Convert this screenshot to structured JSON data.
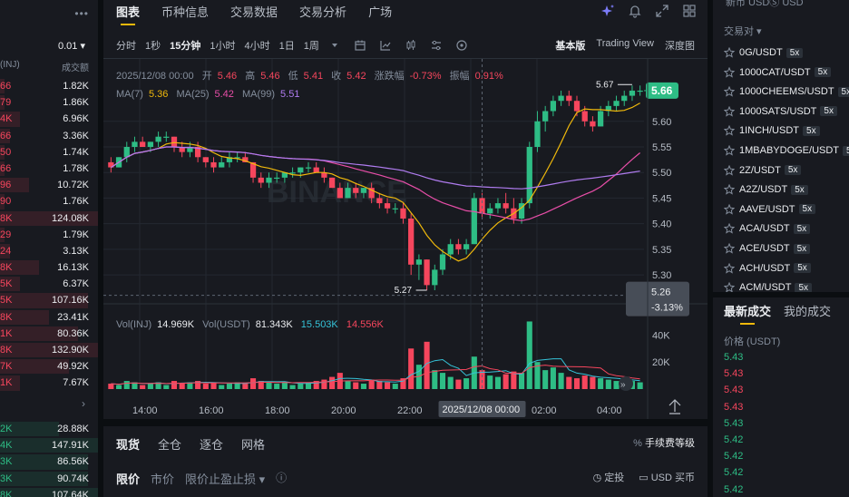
{
  "orderbook": {
    "menu_icon": "more-dots-icon",
    "precision": "0.01 ▾",
    "col_price": "(INJ)",
    "col_total": "成交额",
    "asks": [
      {
        "price": "66",
        "total": "1.82K",
        "depth": 0.05
      },
      {
        "price": "79",
        "total": "1.86K",
        "depth": 0.05
      },
      {
        "price": "4K",
        "total": "6.96K",
        "depth": 0.2
      },
      {
        "price": "66",
        "total": "3.36K",
        "depth": 0.1
      },
      {
        "price": "50",
        "total": "1.74K",
        "depth": 0.05
      },
      {
        "price": "66",
        "total": "1.78K",
        "depth": 0.05
      },
      {
        "price": "96",
        "total": "10.72K",
        "depth": 0.3
      },
      {
        "price": "90",
        "total": "1.76K",
        "depth": 0.05
      },
      {
        "price": "8K",
        "total": "124.08K",
        "depth": 1.0
      },
      {
        "price": "29",
        "total": "1.79K",
        "depth": 0.05
      },
      {
        "price": "24",
        "total": "3.13K",
        "depth": 0.1
      },
      {
        "price": "8K",
        "total": "16.13K",
        "depth": 0.4
      },
      {
        "price": "5K",
        "total": "6.37K",
        "depth": 0.2
      },
      {
        "price": "5K",
        "total": "107.16K",
        "depth": 0.9
      },
      {
        "price": "8K",
        "total": "23.41K",
        "depth": 0.5
      },
      {
        "price": "1K",
        "total": "80.36K",
        "depth": 0.8
      },
      {
        "price": "8K",
        "total": "132.90K",
        "depth": 1.0
      },
      {
        "price": "7K",
        "total": "49.92K",
        "depth": 0.7
      },
      {
        "price": "1K",
        "total": "7.67K",
        "depth": 0.2
      }
    ],
    "mid_arrow": "›",
    "bids": [
      {
        "price": "2K",
        "total": "28.88K",
        "depth": 0.6
      },
      {
        "price": "4K",
        "total": "147.91K",
        "depth": 1.0
      },
      {
        "price": "3K",
        "total": "86.56K",
        "depth": 0.9
      },
      {
        "price": "3K",
        "total": "90.74K",
        "depth": 0.9
      },
      {
        "price": "8K",
        "total": "107.64K",
        "depth": 1.0
      }
    ]
  },
  "chart_panel": {
    "tabs": [
      {
        "label": "图表",
        "active": true
      },
      {
        "label": "币种信息",
        "active": false
      },
      {
        "label": "交易数据",
        "active": false
      },
      {
        "label": "交易分析",
        "active": false
      },
      {
        "label": "广场",
        "active": false
      }
    ],
    "top_icons": [
      "sparkle-icon",
      "bell-icon",
      "expand-icon",
      "grid-icon"
    ],
    "intervals": [
      {
        "label": "分时",
        "active": false
      },
      {
        "label": "1秒",
        "active": false
      },
      {
        "label": "15分钟",
        "active": true
      },
      {
        "label": "1小时",
        "active": false
      },
      {
        "label": "4小时",
        "active": false
      },
      {
        "label": "1日",
        "active": false
      },
      {
        "label": "1周",
        "active": false
      }
    ],
    "tool_icons": [
      "caret-down-icon",
      "calendar-icon",
      "line-chart-icon",
      "candles-icon",
      "settings-sliders-icon",
      "target-icon"
    ],
    "views": [
      {
        "label": "基本版",
        "active": true
      },
      {
        "label": "Trading View",
        "active": false
      },
      {
        "label": "深度图",
        "active": false
      }
    ],
    "ohlc": {
      "date": "2025/12/08 00:00",
      "open_label": "开",
      "open": "5.46",
      "high_label": "高",
      "high": "5.46",
      "low_label": "低",
      "low": "5.41",
      "close_label": "收",
      "close": "5.42",
      "chg_label": "涨跌幅",
      "chg": "-0.73%",
      "amp_label": "振幅",
      "amp": "0.91%"
    },
    "ma": {
      "ma7_label": "MA(7)",
      "ma7": "5.36",
      "ma25_label": "MA(25)",
      "ma25": "5.42",
      "ma99_label": "MA(99)",
      "ma99": "5.51"
    },
    "vol": {
      "label_inj": "Vol(INJ)",
      "inj": "14.969K",
      "label_usdt": "Vol(USDT)",
      "usdt": "81.343K",
      "v1": "15.503K",
      "v2": "14.556K"
    },
    "watermark": "BINANCE",
    "last_price": "5.66",
    "cursor_price": "5.26",
    "cursor_pct": "-3.13%",
    "high_marker": "5.67",
    "low_marker": "5.27",
    "cursor_time": "2025/12/08 00:00",
    "price_ticks": [
      "5.60",
      "5.55",
      "5.50",
      "5.45",
      "5.40",
      "5.35",
      "5.30"
    ],
    "vol_ticks": [
      "40K",
      "20K"
    ],
    "time_ticks": [
      "14:00",
      "16:00",
      "18:00",
      "20:00",
      "22:00",
      "02:00",
      "04:00"
    ],
    "colors": {
      "up": "#2ebd85",
      "down": "#f6465d",
      "ma7": "#f0b90b",
      "ma25": "#e84ea8",
      "ma99": "#b07cf0",
      "vol_ma": "#35c3d8"
    }
  },
  "chart_data": {
    "type": "candlestick",
    "interval": "15m",
    "ylim": [
      5.27,
      5.69
    ],
    "volume_ylim": [
      0,
      55000
    ],
    "candles": [
      [
        5.52,
        5.53,
        5.5,
        5.51
      ],
      [
        5.51,
        5.53,
        5.51,
        5.53
      ],
      [
        5.53,
        5.56,
        5.52,
        5.55
      ],
      [
        5.55,
        5.57,
        5.54,
        5.56
      ],
      [
        5.56,
        5.57,
        5.55,
        5.55
      ],
      [
        5.55,
        5.56,
        5.54,
        5.56
      ],
      [
        5.56,
        5.58,
        5.55,
        5.57
      ],
      [
        5.57,
        5.58,
        5.56,
        5.57
      ],
      [
        5.57,
        5.57,
        5.54,
        5.55
      ],
      [
        5.55,
        5.56,
        5.53,
        5.54
      ],
      [
        5.54,
        5.56,
        5.53,
        5.55
      ],
      [
        5.55,
        5.56,
        5.52,
        5.53
      ],
      [
        5.53,
        5.53,
        5.51,
        5.52
      ],
      [
        5.52,
        5.53,
        5.5,
        5.51
      ],
      [
        5.51,
        5.53,
        5.51,
        5.52
      ],
      [
        5.52,
        5.54,
        5.51,
        5.53
      ],
      [
        5.53,
        5.54,
        5.52,
        5.53
      ],
      [
        5.53,
        5.54,
        5.52,
        5.52
      ],
      [
        5.52,
        5.52,
        5.48,
        5.49
      ],
      [
        5.49,
        5.5,
        5.47,
        5.48
      ],
      [
        5.48,
        5.5,
        5.47,
        5.49
      ],
      [
        5.49,
        5.5,
        5.48,
        5.49
      ],
      [
        5.49,
        5.5,
        5.48,
        5.5
      ],
      [
        5.5,
        5.51,
        5.49,
        5.5
      ],
      [
        5.5,
        5.51,
        5.49,
        5.51
      ],
      [
        5.51,
        5.52,
        5.5,
        5.51
      ],
      [
        5.51,
        5.52,
        5.5,
        5.5
      ],
      [
        5.5,
        5.51,
        5.48,
        5.49
      ],
      [
        5.49,
        5.49,
        5.47,
        5.47
      ],
      [
        5.47,
        5.48,
        5.45,
        5.45
      ],
      [
        5.45,
        5.48,
        5.45,
        5.47
      ],
      [
        5.47,
        5.48,
        5.45,
        5.46
      ],
      [
        5.46,
        5.47,
        5.45,
        5.47
      ],
      [
        5.47,
        5.48,
        5.44,
        5.45
      ],
      [
        5.45,
        5.46,
        5.43,
        5.44
      ],
      [
        5.44,
        5.45,
        5.42,
        5.43
      ],
      [
        5.43,
        5.44,
        5.42,
        5.43
      ],
      [
        5.43,
        5.44,
        5.4,
        5.41
      ],
      [
        5.41,
        5.42,
        5.3,
        5.32
      ],
      [
        5.32,
        5.34,
        5.29,
        5.33
      ],
      [
        5.33,
        5.33,
        5.27,
        5.28
      ],
      [
        5.28,
        5.32,
        5.27,
        5.31
      ],
      [
        5.31,
        5.35,
        5.3,
        5.34
      ],
      [
        5.34,
        5.37,
        5.33,
        5.36
      ],
      [
        5.36,
        5.37,
        5.34,
        5.35
      ],
      [
        5.35,
        5.37,
        5.34,
        5.36
      ],
      [
        5.36,
        5.46,
        5.36,
        5.45
      ],
      [
        5.45,
        5.46,
        5.41,
        5.42
      ],
      [
        5.42,
        5.44,
        5.41,
        5.43
      ],
      [
        5.43,
        5.45,
        5.42,
        5.44
      ],
      [
        5.44,
        5.46,
        5.42,
        5.43
      ],
      [
        5.43,
        5.45,
        5.4,
        5.41
      ],
      [
        5.41,
        5.45,
        5.4,
        5.44
      ],
      [
        5.44,
        5.56,
        5.43,
        5.55
      ],
      [
        5.55,
        5.62,
        5.54,
        5.6
      ],
      [
        5.6,
        5.63,
        5.58,
        5.62
      ],
      [
        5.62,
        5.65,
        5.61,
        5.64
      ],
      [
        5.64,
        5.66,
        5.63,
        5.65
      ],
      [
        5.65,
        5.66,
        5.63,
        5.64
      ],
      [
        5.64,
        5.65,
        5.61,
        5.62
      ],
      [
        5.62,
        5.63,
        5.59,
        5.6
      ],
      [
        5.6,
        5.61,
        5.58,
        5.59
      ],
      [
        5.59,
        5.63,
        5.59,
        5.62
      ],
      [
        5.62,
        5.64,
        5.61,
        5.63
      ],
      [
        5.63,
        5.65,
        5.62,
        5.64
      ],
      [
        5.64,
        5.66,
        5.63,
        5.65
      ],
      [
        5.65,
        5.67,
        5.64,
        5.66
      ],
      [
        5.66,
        5.67,
        5.65,
        5.66
      ]
    ],
    "volumes": [
      4,
      3,
      6,
      5,
      3,
      4,
      5,
      3,
      6,
      4,
      5,
      6,
      4,
      5,
      3,
      4,
      5,
      4,
      8,
      6,
      5,
      4,
      5,
      3,
      4,
      5,
      6,
      7,
      9,
      12,
      6,
      5,
      4,
      7,
      6,
      5,
      4,
      8,
      30,
      18,
      35,
      14,
      12,
      9,
      7,
      8,
      24,
      14,
      10,
      9,
      11,
      13,
      12,
      50,
      20,
      14,
      16,
      12,
      9,
      8,
      10,
      9,
      8,
      7,
      6,
      7,
      6,
      5
    ]
  },
  "trade_panel": {
    "tabs": [
      {
        "label": "现货",
        "active": true
      },
      {
        "label": "全仓",
        "active": false
      },
      {
        "label": "逐仓",
        "active": false
      },
      {
        "label": "网格",
        "active": false
      }
    ],
    "fee_label": "手续费等级",
    "fee_icon": "percent-icon",
    "order_types": [
      {
        "label": "限价",
        "active": true
      },
      {
        "label": "市价",
        "active": false
      },
      {
        "label": "限价止盈止损 ▾",
        "active": false
      }
    ],
    "info_icon": "info-icon",
    "dca_label": "定投",
    "buy_label": "USD 买币"
  },
  "market_list": {
    "top_tabs": "新币   USDⓈ   USD",
    "pair_header": "交易对 ▾",
    "pairs": [
      {
        "name": "0G/USDT",
        "lev": "5x"
      },
      {
        "name": "1000CAT/USDT",
        "lev": "5x"
      },
      {
        "name": "1000CHEEMS/USDT",
        "lev": "5x"
      },
      {
        "name": "1000SATS/USDT",
        "lev": "5x"
      },
      {
        "name": "1INCH/USDT",
        "lev": "5x"
      },
      {
        "name": "1MBABYDOGE/USDT",
        "lev": "5x"
      },
      {
        "name": "2Z/USDT",
        "lev": "5x"
      },
      {
        "name": "A2Z/USDT",
        "lev": "5x"
      },
      {
        "name": "AAVE/USDT",
        "lev": "5x"
      },
      {
        "name": "ACA/USDT",
        "lev": "5x"
      },
      {
        "name": "ACE/USDT",
        "lev": "5x"
      },
      {
        "name": "ACH/USDT",
        "lev": "5x"
      },
      {
        "name": "ACM/USDT",
        "lev": "5x"
      }
    ],
    "trade_tabs": [
      {
        "label": "最新成交",
        "active": true
      },
      {
        "label": "我的成交",
        "active": false
      }
    ],
    "price_header": "价格 (USDT)",
    "trades": [
      {
        "price": "5.43",
        "side": "up"
      },
      {
        "price": "5.43",
        "side": "down"
      },
      {
        "price": "5.43",
        "side": "down"
      },
      {
        "price": "5.43",
        "side": "down"
      },
      {
        "price": "5.43",
        "side": "up"
      },
      {
        "price": "5.42",
        "side": "up"
      },
      {
        "price": "5.42",
        "side": "up"
      },
      {
        "price": "5.42",
        "side": "up"
      },
      {
        "price": "5.42",
        "side": "up"
      }
    ]
  }
}
